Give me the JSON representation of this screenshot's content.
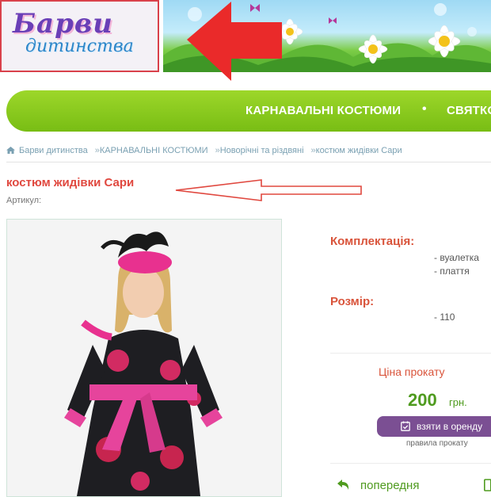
{
  "header": {
    "logo_line1": "Барви",
    "logo_line2": "дитинства"
  },
  "nav": {
    "items": [
      "КАРНАВАЛЬНІ КОСТЮМИ",
      "СВЯТКО"
    ],
    "separator": "•"
  },
  "breadcrumb": {
    "items": [
      "Барви дитинства",
      "КАРНАВАЛЬНІ КОСТЮМИ",
      "Новорічні та різдвяні",
      "костюм жидівки Сари"
    ],
    "separator": "»"
  },
  "product": {
    "title": "костюм жидівки Сари",
    "sku_label": "Артикул:"
  },
  "specs": {
    "set_label": "Комплектація:",
    "set_items": [
      "- вуалетка",
      "- плаття"
    ],
    "size_label": "Розмір:",
    "size_value": "- 110"
  },
  "rent": {
    "heading": "Ціна прокату",
    "price": "200",
    "currency": "грн.",
    "button_label": "взяти в оренду",
    "rules_link": "правила прокату"
  },
  "pager": {
    "prev_label": "попередня"
  },
  "colors": {
    "accent_red": "#e0483f",
    "nav_green": "#86c91c",
    "price_green": "#4f9b1f",
    "button_purple": "#7b4f93"
  }
}
